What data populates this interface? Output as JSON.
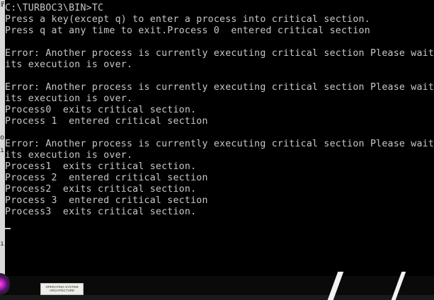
{
  "console": {
    "lines": [
      "C:\\TURBOC3\\BIN>TC",
      "Press a key(except q) to enter a process into critical section.",
      "Press q at any time to exit.Process 0  entered critical section",
      "",
      "Error: Another process is currently executing critical section Please wait t",
      "its execution is over.",
      "",
      "Error: Another process is currently executing critical section Please wait t",
      "its execution is over.",
      "Process0  exits critical section.",
      "Process 1  entered critical section",
      "",
      "Error: Another process is currently executing critical section Please wait t",
      "its execution is over.",
      "Process1  exits critical section.",
      "Process 2  entered critical section",
      "Process2  exits critical section.",
      "Process 3  entered critical section",
      "Process3  exits critical section."
    ]
  },
  "desktop": {
    "book_title": "OPERATING SYSTEM ARCHITECTURE"
  },
  "colors": {
    "console_bg": "#000000",
    "console_text": "#c8c8c8"
  }
}
